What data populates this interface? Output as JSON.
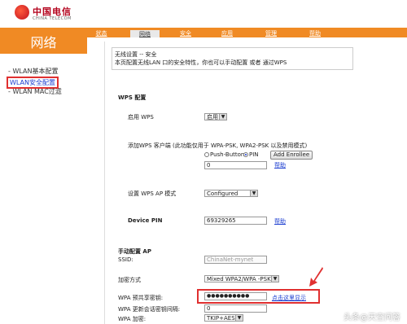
{
  "brand": {
    "name_cn": "中国电信",
    "name_en": "CHINA TELECOM"
  },
  "section_title": "网络",
  "nav": {
    "tabs": [
      {
        "label": "状态",
        "active": false
      },
      {
        "label": "网络",
        "active": true
      },
      {
        "label": "安全",
        "active": false
      },
      {
        "label": "应用",
        "active": false
      },
      {
        "label": "管理",
        "active": false
      },
      {
        "label": "帮助",
        "active": false
      }
    ]
  },
  "sidebar": {
    "items": [
      {
        "label": "WLAN基本配置"
      },
      {
        "label": "WLAN安全配置"
      },
      {
        "label": "WLAN MAC过滤"
      }
    ]
  },
  "notice": {
    "line1": "无线设置 -- 安全",
    "line2": "本页配置无线LAN 口的安全特性，你也可以手动配置 或者 通过WPS"
  },
  "wps": {
    "heading": "WPS 配置",
    "enable_label": "启用 WPS",
    "enable_value": "启用",
    "client_label": "添加WPS 客户端 (此功能仅用于 WPA-PSK, WPA2-PSK 以及禁用模式)",
    "radio_push": "Push-Button",
    "radio_pin": "PIN",
    "add_enrollee": "Add Enrollee",
    "pin_value": "0",
    "help1": "帮助",
    "ap_mode_label": "设置 WPS AP 模式",
    "ap_mode_value": "Configured",
    "device_pin_label": "Device PIN",
    "device_pin_value": "69329265",
    "help2": "帮助"
  },
  "manual": {
    "heading": "手动配置 AP",
    "ssid_label": "SSID:",
    "ssid_value": "ChinaNet-mynet",
    "enc_label": "加密方式",
    "enc_value": "Mixed WPA2/WPA -PSK",
    "psk_label": "WPA 预共享密钥:",
    "psk_value": "●●●●●●●●●●",
    "psk_link": "点击这里显示",
    "rekey_label": "WPA 更新会话密钥间隔:",
    "rekey_value": "0",
    "wpa_enc_label": "WPA 加密:",
    "wpa_enc_value": "TKIP+AES"
  },
  "watermark": "头条@天空问答",
  "colors": {
    "accent": "#f08a24",
    "link": "#1a3cd0",
    "highlight": "#e03030"
  }
}
